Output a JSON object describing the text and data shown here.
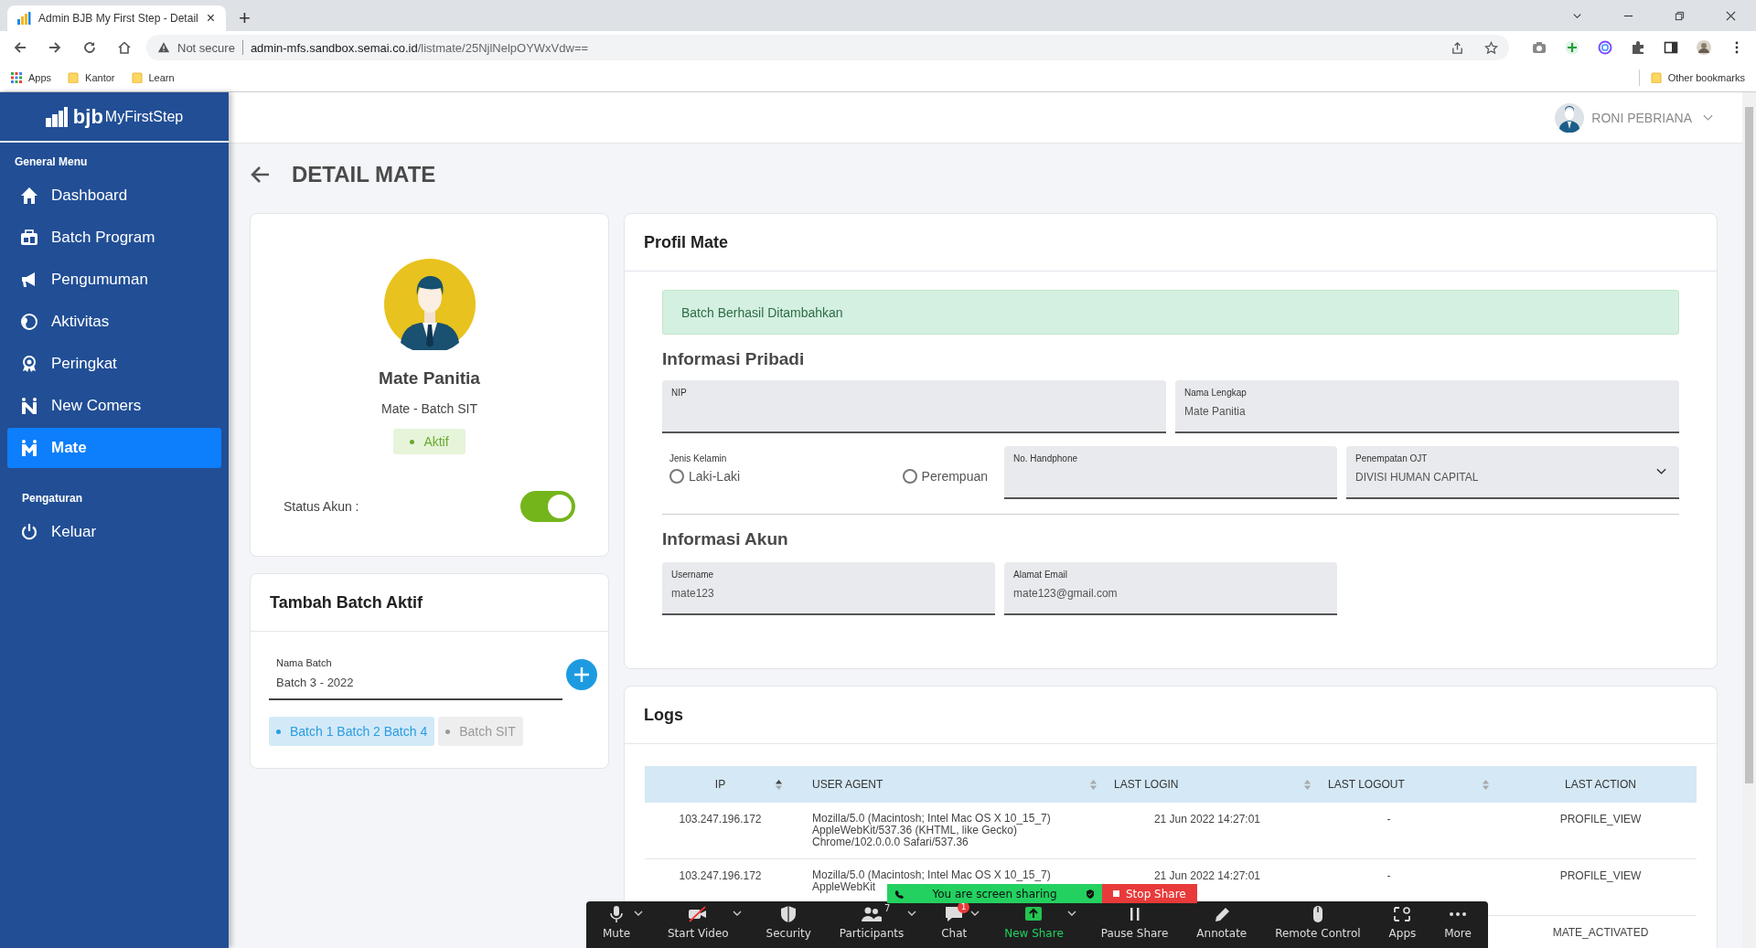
{
  "browser": {
    "tab_title": "Admin BJB My First Step - Detail",
    "tab_close": "×",
    "new_tab": "+",
    "security": "Not secure",
    "url_host": "admin-mfs.sandbox.semai.co.id",
    "url_path": "/listmate/25NjlNelpOYWxVdw==",
    "bookmarks": [
      {
        "label": "Apps",
        "kind": "apps"
      },
      {
        "label": "Kantor",
        "kind": "folder"
      },
      {
        "label": "Learn",
        "kind": "folder"
      }
    ],
    "other_bookmarks": "Other bookmarks"
  },
  "sidebar": {
    "logo_bold": "bjb",
    "logo_text": "MyFirstStep",
    "sections": [
      {
        "title": "General Menu",
        "items": [
          {
            "label": "Dashboard",
            "selected": false
          },
          {
            "label": "Batch Program",
            "selected": false
          },
          {
            "label": "Pengumuman",
            "selected": false
          },
          {
            "label": "Aktivitas",
            "selected": false
          },
          {
            "label": "Peringkat",
            "selected": false
          },
          {
            "label": "New Comers",
            "selected": false
          },
          {
            "label": "Mate",
            "selected": true
          }
        ]
      },
      {
        "title": "Pengaturan",
        "items": [
          {
            "label": "Keluar",
            "selected": false
          }
        ]
      }
    ]
  },
  "header": {
    "user": "RONI PEBRIANA"
  },
  "page_title": "DETAIL MATE",
  "profile": {
    "name": "Mate Panitia",
    "subtitle": "Mate - Batch SIT",
    "status": "Aktif",
    "account_label": "Status Akun :",
    "account_on": true
  },
  "batch": {
    "title": "Tambah Batch Aktif",
    "field_label": "Nama Batch",
    "field_value": "Batch 3 - 2022",
    "tags": [
      {
        "label": "Batch 1 Batch 2 Batch 4",
        "active": true
      },
      {
        "label": "Batch SIT",
        "active": false
      }
    ]
  },
  "profil_mate": {
    "title": "Profil Mate",
    "alert": "Batch Berhasil Ditambahkan",
    "personal": {
      "title": "Informasi Pribadi",
      "nip": {
        "label": "NIP"
      },
      "full_name": {
        "label": "Nama Lengkap",
        "value": "Mate Panitia"
      },
      "gender": {
        "label": "Jenis Kelamin",
        "options": [
          {
            "label": "Laki-Laki",
            "selected": false
          },
          {
            "label": "Perempuan",
            "selected": false
          }
        ]
      },
      "phone": {
        "label": "No. Handphone"
      },
      "placement": {
        "label": "Penempatan OJT",
        "value": "DIVISI HUMAN CAPITAL"
      }
    },
    "account": {
      "title": "Informasi Akun",
      "username": {
        "label": "Username",
        "value": "mate123"
      },
      "email": {
        "label": "Alamat Email",
        "value": "mate123@gmail.com"
      }
    }
  },
  "logs": {
    "title": "Logs",
    "columns": [
      {
        "label": "IP",
        "sortable": true,
        "sorted": true
      },
      {
        "label": "USER AGENT",
        "sortable": true,
        "sorted": false
      },
      {
        "label": "LAST LOGIN",
        "sortable": true,
        "sorted": false
      },
      {
        "label": "LAST LOGOUT",
        "sortable": true,
        "sorted": false
      },
      {
        "label": "LAST ACTION",
        "sortable": false
      }
    ],
    "rows": [
      {
        "ip": "103.247.196.172",
        "user_agent": [
          "Mozilla/5.0 (Macintosh; Intel Mac OS X 10_15_7)",
          "AppleWebKit/537.36 (KHTML, like Gecko)",
          "Chrome/102.0.0.0 Safari/537.36"
        ],
        "last_login": "21 Jun 2022 14:27:01",
        "last_logout": "-",
        "last_action": "PROFILE_VIEW"
      },
      {
        "ip": "103.247.196.172",
        "user_agent": [
          "Mozilla/5.0 (Macintosh; Intel Mac OS X 10_15_7)",
          "AppleWebKit"
        ],
        "last_login": "21 Jun 2022 14:27:01",
        "last_logout": "-",
        "last_action": "PROFILE_VIEW"
      },
      {
        "last_action": "MATE_ACTIVATED"
      }
    ]
  },
  "zoom": {
    "banner": "You are screen sharing",
    "stop": "Stop Share",
    "items": [
      {
        "label": "Mute",
        "kind": "mic",
        "caret": true
      },
      {
        "label": "Start Video",
        "kind": "video",
        "caret": true
      },
      {
        "label": "Security",
        "kind": "shield",
        "caret": false
      },
      {
        "label": "Participants",
        "kind": "people",
        "count": "7",
        "caret": true
      },
      {
        "label": "Chat",
        "kind": "chat",
        "badge": "1",
        "caret": true
      },
      {
        "label": "New Share",
        "kind": "share",
        "caret": true
      },
      {
        "label": "Pause Share",
        "kind": "pause",
        "caret": false
      },
      {
        "label": "Annotate",
        "kind": "pen",
        "caret": false
      },
      {
        "label": "Remote Control",
        "kind": "mouse",
        "caret": false
      },
      {
        "label": "Apps",
        "kind": "apps",
        "caret": false
      },
      {
        "label": "More",
        "kind": "more",
        "caret": false
      }
    ]
  }
}
